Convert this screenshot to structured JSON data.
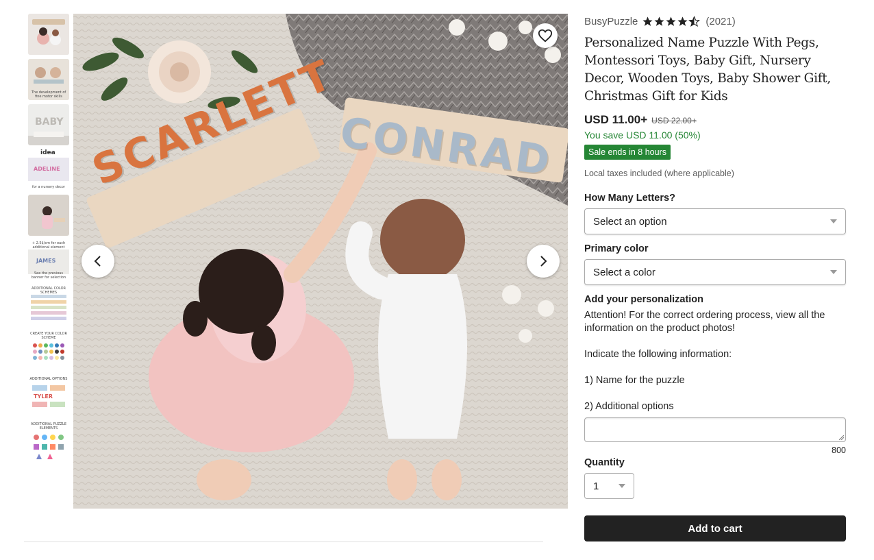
{
  "shop": {
    "name": "BusyPuzzle",
    "rating": 4.5,
    "review_count": "(2021)"
  },
  "product": {
    "title": "Personalized Name Puzzle With Pegs, Montessori Toys, Baby Gift, Nursery Decor, Wooden Toys, Baby Shower Gift, Christmas Gift for Kids",
    "price": "USD 11.00+",
    "original_price": "USD 22.00+",
    "savings": "You save USD 11.00 (50%)",
    "sale_badge": "Sale ends in 8 hours",
    "taxes_note": "Local taxes included (where applicable)"
  },
  "options": {
    "letters_label": "How Many Letters?",
    "letters_value": "Select an option",
    "color_label": "Primary color",
    "color_value": "Select a color"
  },
  "personalization": {
    "label": "Add your personalization",
    "instructions": "Attention! For the correct ordering process, view all the information on the product photos!",
    "line1": "Indicate the following information:",
    "line2": "1) Name for the puzzle",
    "line3": "2) Additional options",
    "char_limit": "800"
  },
  "quantity": {
    "label": "Quantity",
    "value": "1"
  },
  "cart_button": "Add to cart",
  "main_image": {
    "puzzle_name_left": "SCARLETT",
    "puzzle_name_right": "CONRAD"
  },
  "thumbnails": [
    {
      "name": "thumb-1",
      "caption": ""
    },
    {
      "name": "thumb-2",
      "caption": "The development of fine motor skills"
    },
    {
      "name": "thumb-3",
      "caption": "BABY"
    },
    {
      "name": "thumb-4",
      "caption": "idea",
      "sub": "for a nursery decor",
      "word": "ADELINE"
    },
    {
      "name": "thumb-5",
      "caption": ""
    },
    {
      "name": "thumb-6",
      "caption": "+ 2.5$/cm for each additional element",
      "sub": "See the previous banner for selection",
      "word": "JAMES"
    },
    {
      "name": "thumb-7",
      "caption": "ADDITIONAL COLOR SCHEMES"
    },
    {
      "name": "thumb-8",
      "caption": "CREATE YOUR COLOR SCHEME"
    },
    {
      "name": "thumb-9",
      "caption": "ADDITIONAL OPTIONS",
      "word": "TYLER"
    },
    {
      "name": "thumb-10",
      "caption": "ADDITIONAL PUZZLE ELEMENTS"
    }
  ],
  "colors": {
    "sale_green": "#258635",
    "button_dark": "#222222",
    "muted_text": "#595959"
  }
}
